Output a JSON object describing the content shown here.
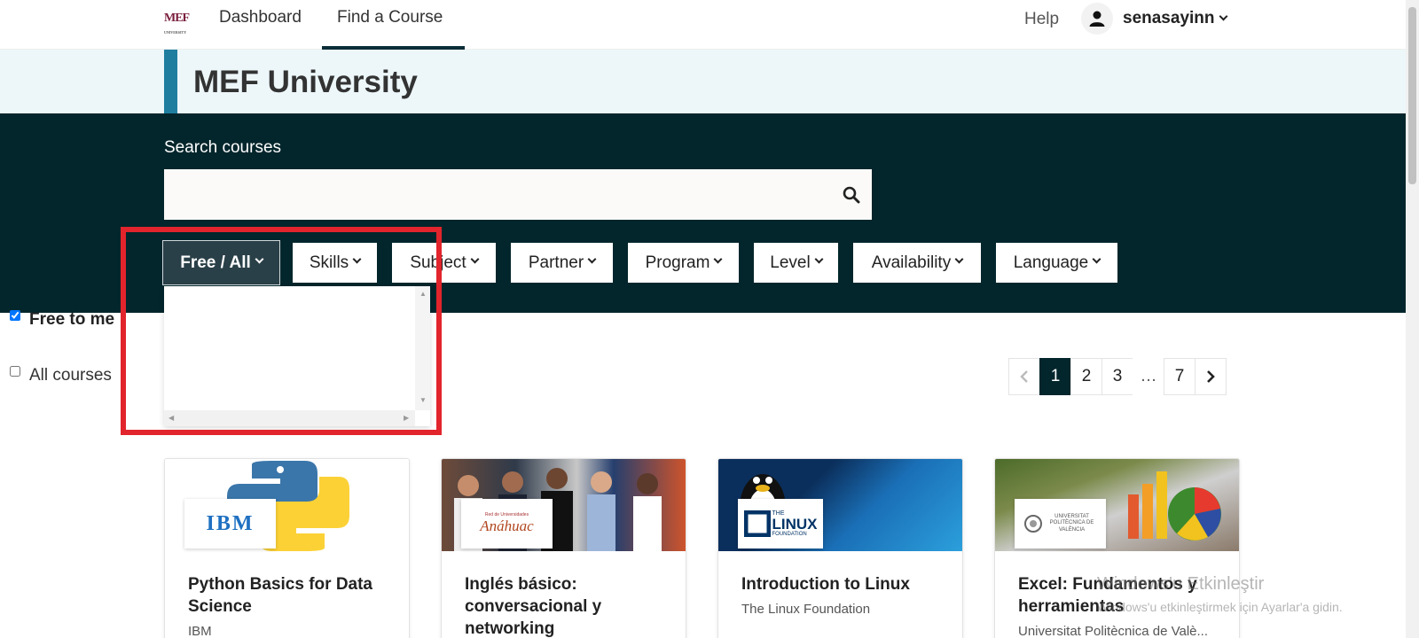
{
  "nav": {
    "logo_text": "MEF",
    "logo_sub": "UNIVERSITY",
    "dashboard": "Dashboard",
    "find_course": "Find a Course",
    "help": "Help",
    "username": "senasayinn"
  },
  "band": {
    "title": "MEF University"
  },
  "search": {
    "label": "Search courses",
    "value": "",
    "placeholder": ""
  },
  "filters": [
    {
      "label": "Free / All"
    },
    {
      "label": "Skills"
    },
    {
      "label": "Subject"
    },
    {
      "label": "Partner"
    },
    {
      "label": "Program"
    },
    {
      "label": "Level"
    },
    {
      "label": "Availability"
    },
    {
      "label": "Language"
    }
  ],
  "dropdown": {
    "free_to_me": "Free to me",
    "all_courses": "All courses"
  },
  "pagination": {
    "pages": [
      "1",
      "2",
      "3",
      "…",
      "7"
    ],
    "current": "1"
  },
  "cards": [
    {
      "title": "Python Basics for Data Science",
      "org": "IBM",
      "logo_text": "IBM"
    },
    {
      "title": "Inglés básico: conversacional y networking",
      "org": "",
      "logo_text": "Anáhuac",
      "logo_small": "Red de Universidades"
    },
    {
      "title": "Introduction to Linux",
      "org": "The Linux Foundation",
      "logo_text": "LINUX",
      "logo_small": "THE",
      "logo_small2": "FOUNDATION"
    },
    {
      "title": "Excel: Fundamentos y herramientas",
      "org": "Universitat Politècnica de Valè...",
      "logo_text": "UNIVERSITAT POLITÈCNICA DE VALÈNCIA"
    }
  ],
  "watermark": {
    "line1": "Windows'u Etkinleştir",
    "line2": "Windows'u etkinleştirmek için Ayarlar'a gidin."
  },
  "colors": {
    "dark_teal": "#03262c",
    "accent_blue": "#1f7ea0",
    "band_bg": "#edf7fa",
    "highlight_red": "#e2242c",
    "active_filter": "#2a4048"
  }
}
